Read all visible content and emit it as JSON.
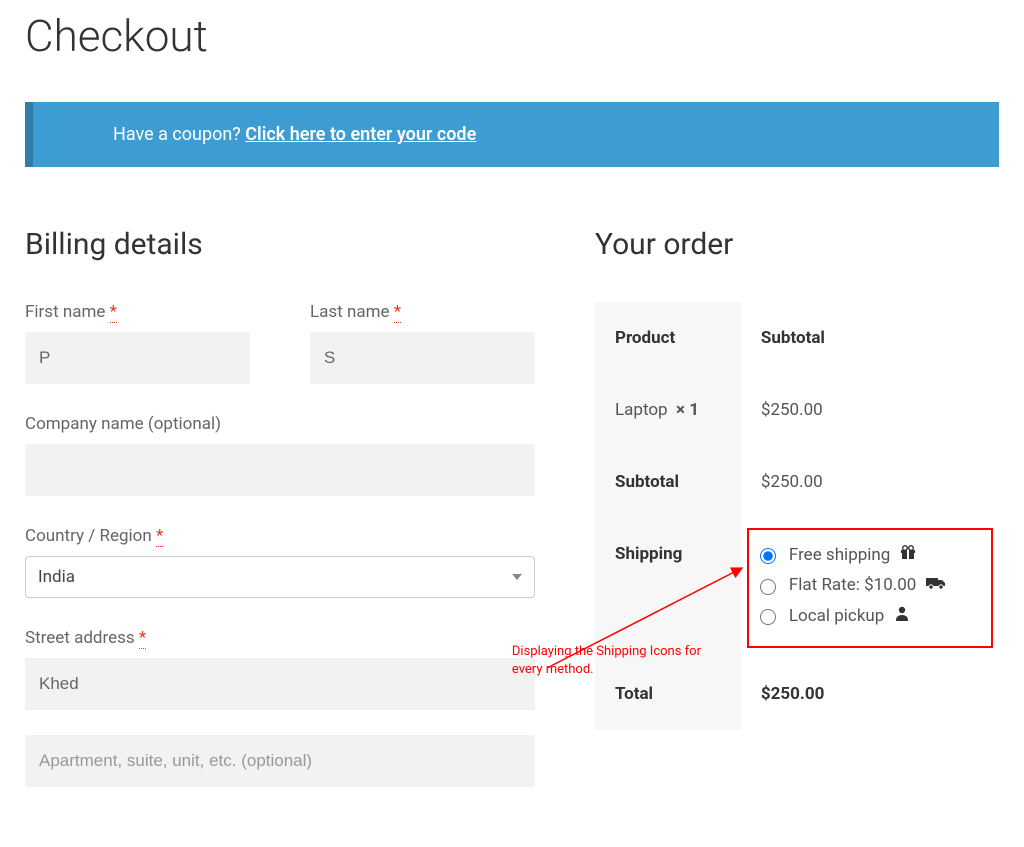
{
  "page_title": "Checkout",
  "coupon": {
    "prompt": "Have a coupon? ",
    "link": "Click here to enter your code"
  },
  "billing": {
    "heading": "Billing details",
    "first_name_label": "First name",
    "last_name_label": "Last name",
    "first_name_value": "P",
    "last_name_value": "S",
    "company_label": "Company name (optional)",
    "company_value": "",
    "country_label": "Country / Region",
    "country_value": "India",
    "street_label": "Street address",
    "street_value": "Khed",
    "street2_placeholder": "Apartment, suite, unit, etc. (optional)",
    "required_mark": "*"
  },
  "order": {
    "heading": "Your order",
    "th_product": "Product",
    "th_subtotal": "Subtotal",
    "item_name": "Laptop",
    "item_qty": "× 1",
    "item_price": "$250.00",
    "subtotal_label": "Subtotal",
    "subtotal_value": "$250.00",
    "shipping_label": "Shipping",
    "shipping_options": {
      "free": "Free shipping",
      "flat": "Flat Rate: $10.00",
      "local": "Local pickup"
    },
    "total_label": "Total",
    "total_value": "$250.00"
  },
  "annotation": "Displaying the Shipping Icons for every method."
}
